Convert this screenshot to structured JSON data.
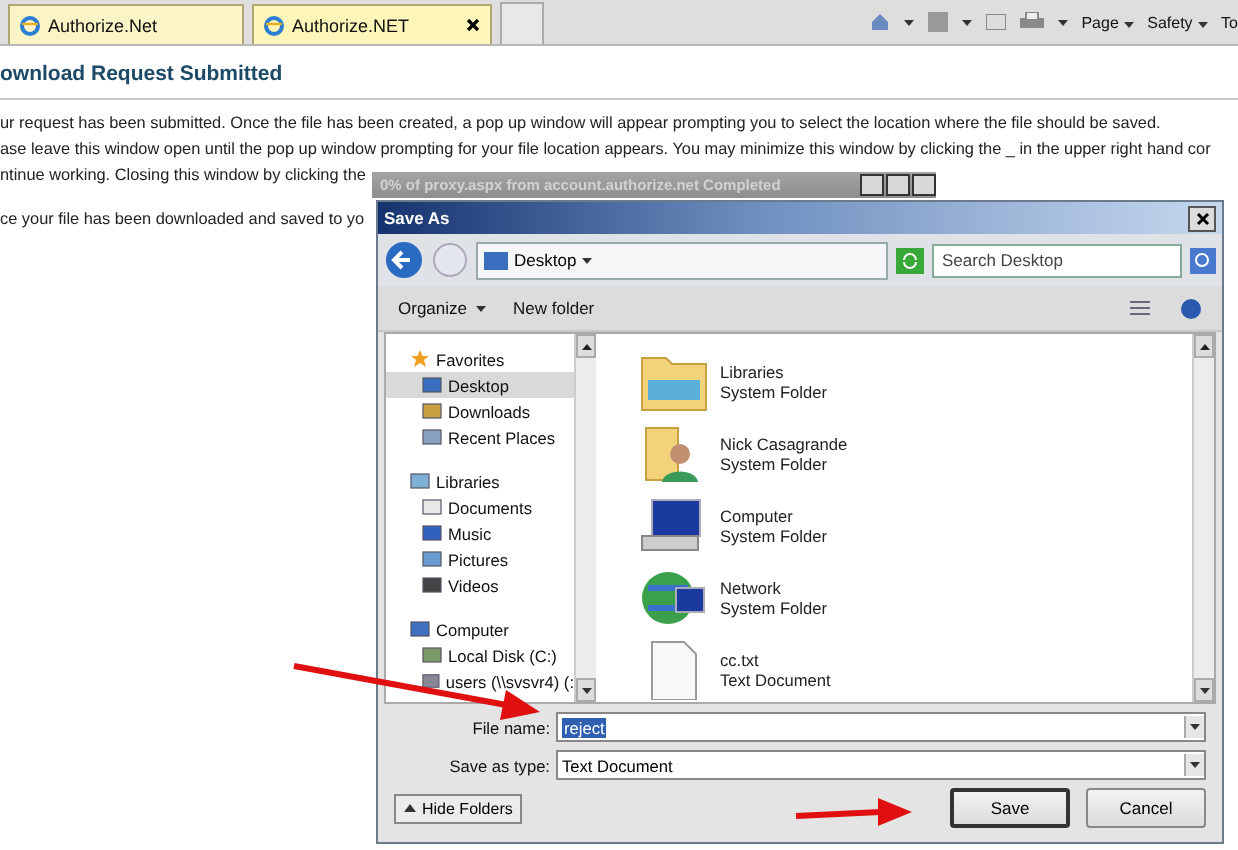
{
  "browser": {
    "tabs": [
      {
        "label": "Authorize.Net",
        "selected": false
      },
      {
        "label": "Authorize.NET",
        "selected": true
      }
    ],
    "commands": [
      {
        "label": "Page"
      },
      {
        "label": "Safety"
      },
      {
        "label": "To"
      }
    ]
  },
  "page": {
    "heading": "ownload Request Submitted",
    "lines": [
      "ur request has been submitted. Once the file has been created, a pop up window will appear prompting you to select the location where the file should be saved.",
      "ase leave this window open until the pop up window prompting for your file location appears. You may minimize this window by clicking the _ in the upper right hand cor",
      "ntinue working. Closing this window by clicking the",
      "ce your file has been downloaded and saved to yo"
    ]
  },
  "progress_window": {
    "title": "0% of proxy.aspx from account.authorize.net Completed"
  },
  "save_dialog": {
    "title": "Save As",
    "location": "Desktop",
    "search": {
      "placeholder": "Search Desktop"
    },
    "toolbar": [
      "Organize",
      "New folder"
    ],
    "nav": [
      {
        "label": "Favorites",
        "kind": "star",
        "selected": false,
        "children": [
          {
            "label": "Desktop",
            "kind": "desktop",
            "selected": true
          },
          {
            "label": "Downloads",
            "kind": "downloads",
            "selected": false
          },
          {
            "label": "Recent Places",
            "kind": "recent",
            "selected": false
          }
        ]
      },
      {
        "label": "Libraries",
        "kind": "library",
        "selected": false,
        "children": [
          {
            "label": "Documents",
            "kind": "document",
            "selected": false
          },
          {
            "label": "Music",
            "kind": "music",
            "selected": false
          },
          {
            "label": "Pictures",
            "kind": "pictures",
            "selected": false
          },
          {
            "label": "Videos",
            "kind": "videos",
            "selected": false
          }
        ]
      },
      {
        "label": "Computer",
        "kind": "computer",
        "selected": false,
        "children": [
          {
            "label": "Local Disk (C:)",
            "kind": "disk",
            "selected": false
          },
          {
            "label": "users (\\\\svsvr4) (:",
            "kind": "drive",
            "selected": false
          }
        ]
      }
    ],
    "files": [
      {
        "name": "Libraries",
        "type": "System Folder",
        "kind": "library"
      },
      {
        "name": "Nick Casagrande",
        "type": "System Folder",
        "kind": "user"
      },
      {
        "name": "Computer",
        "type": "System Folder",
        "kind": "computer"
      },
      {
        "name": "Network",
        "type": "System Folder",
        "kind": "network"
      },
      {
        "name": "cc.txt",
        "type": "Text Document",
        "kind": "text"
      }
    ],
    "file_name": {
      "label": "File name:",
      "value": "reject",
      "value_selected": true
    },
    "save_as_type": {
      "label": "Save as type:",
      "value": "Text Document"
    },
    "hide_folders": "Hide Folders",
    "buttons": [
      {
        "label": "Save",
        "default": true
      },
      {
        "label": "Cancel",
        "default": false
      }
    ]
  }
}
